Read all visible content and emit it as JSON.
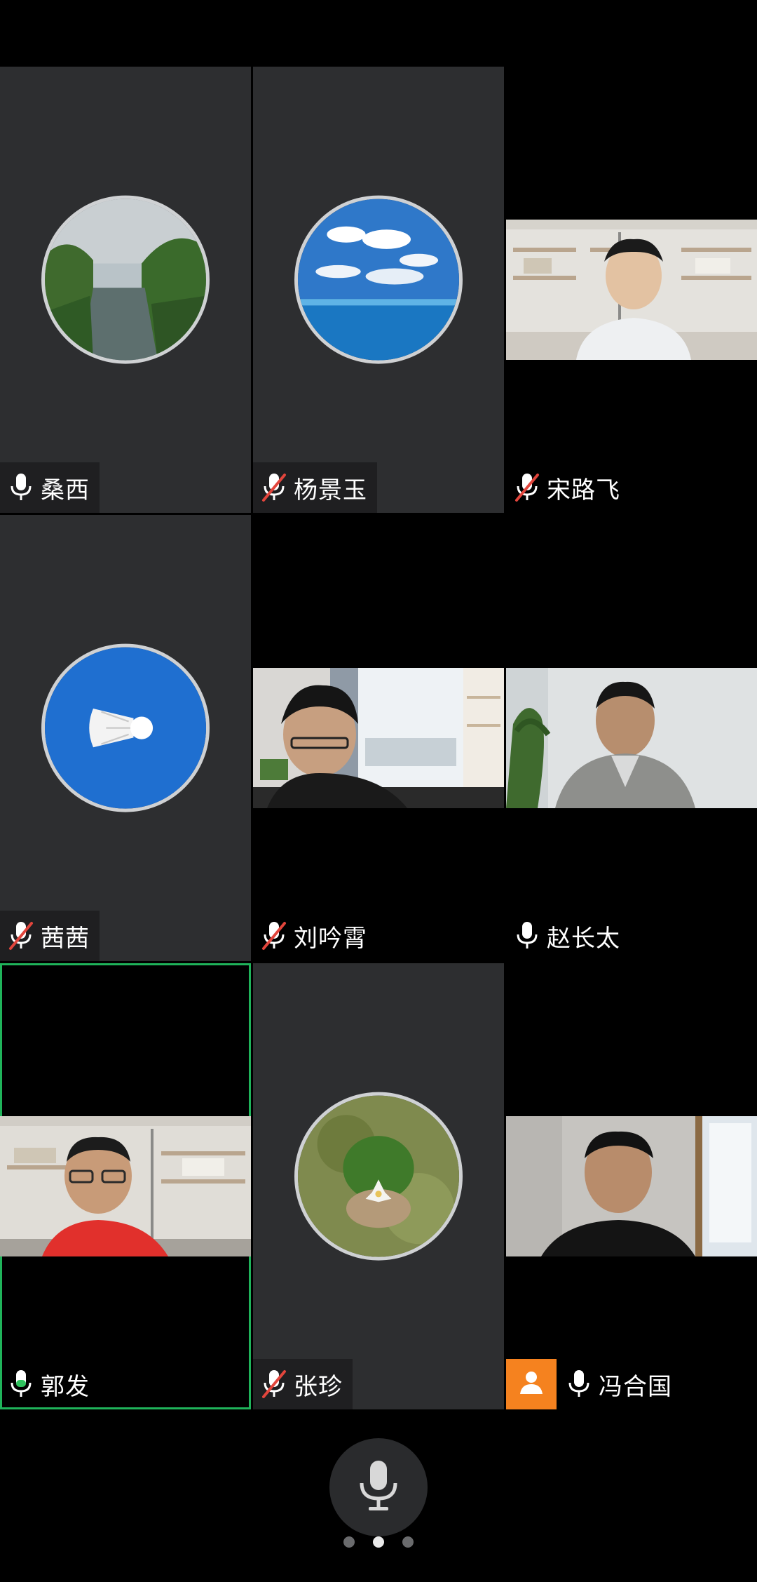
{
  "participants": [
    {
      "name": "桑西",
      "mic": "on",
      "view": "avatar",
      "avatar": "river-landscape"
    },
    {
      "name": "杨景玉",
      "mic": "muted",
      "view": "avatar",
      "avatar": "sea-and-sky"
    },
    {
      "name": "宋路飞",
      "mic": "muted",
      "view": "video",
      "avatar": "bookshelf-room"
    },
    {
      "name": "茜茜",
      "mic": "muted",
      "view": "avatar",
      "avatar": "shuttlecock-sky"
    },
    {
      "name": "刘吟霄",
      "mic": "muted",
      "view": "video",
      "avatar": "window-room"
    },
    {
      "name": "赵长太",
      "mic": "on",
      "view": "video",
      "avatar": "plant-room"
    },
    {
      "name": "郭发",
      "mic": "speaking",
      "view": "video",
      "avatar": "bookshelf-room-red",
      "active": true
    },
    {
      "name": "张珍",
      "mic": "muted",
      "view": "avatar",
      "avatar": "moss-flower"
    },
    {
      "name": "冯合国",
      "mic": "on",
      "view": "video",
      "avatar": "window-room-2",
      "host": true
    }
  ],
  "controls": {
    "mic_button": "microphone-icon",
    "pages": 3,
    "current_page": 2
  },
  "colors": {
    "tile_bg": "#2d2e30",
    "active_border": "#1fb35a",
    "muted_slash": "#e2453c",
    "host_badge": "#f5821f"
  }
}
